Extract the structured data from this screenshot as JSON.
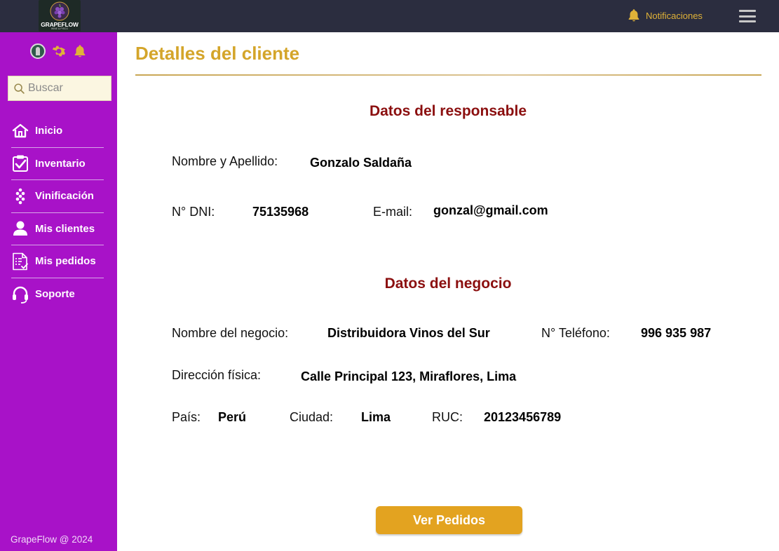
{
  "app": {
    "logo_text": "GRAPEFLOW",
    "logo_sub": "WINE & PISCO"
  },
  "topbar": {
    "notifications_label": "Notificaciones",
    "icons": [
      "bell-icon",
      "hamburger-menu-icon"
    ]
  },
  "sidebar": {
    "search_placeholder": "Buscar",
    "items": [
      {
        "label": "Inicio",
        "icon": "home-icon"
      },
      {
        "label": "Inventario",
        "icon": "clipboard-check-icon"
      },
      {
        "label": "Vinificación",
        "icon": "grapes-icon"
      },
      {
        "label": "Mis clientes",
        "icon": "user-icon"
      },
      {
        "label": "Mis pedidos",
        "icon": "document-list-icon"
      },
      {
        "label": "Soporte",
        "icon": "headset-icon"
      }
    ],
    "footer": "GrapeFlow  @ 2024"
  },
  "main": {
    "title": "Detalles del cliente",
    "responsable": {
      "section_title": "Datos del responsable",
      "name_label": "Nombre y Apellido:",
      "name_value": "Gonzalo Saldaña",
      "dni_label": "N° DNI:",
      "dni_value": "75135968",
      "email_label": "E-mail:",
      "email_value": "gonzal@gmail.com"
    },
    "negocio": {
      "section_title": "Datos del  negocio",
      "business_label": "Nombre del negocio:",
      "business_value": "Distribuidora Vinos del Sur",
      "phone_label": "N° Teléfono:",
      "phone_value": "996 935 987",
      "address_label": "Dirección física:",
      "address_value": "Calle Principal 123, Miraflores, Lima",
      "country_label": "País:",
      "country_value": "Perú",
      "city_label": "Ciudad:",
      "city_value": "Lima",
      "ruc_label": "RUC:",
      "ruc_value": "20123456789"
    },
    "button_label": "Ver Pedidos"
  },
  "colors": {
    "topbar": "#2b2d3f",
    "sidebar": "#a812c8",
    "accent_gold": "#e3a320",
    "title_gold": "#d4a52a",
    "section_red": "#8b0f0f"
  }
}
